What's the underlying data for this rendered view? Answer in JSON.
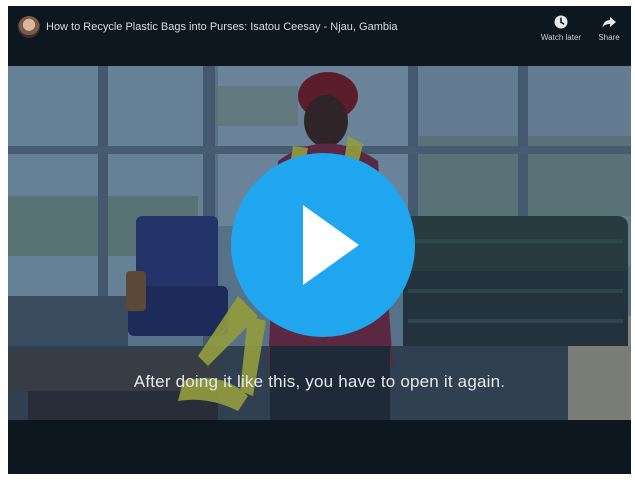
{
  "player": {
    "title": "How to Recycle Plastic Bags into Purses: Isatou Ceesay - Njau, Gambia",
    "watch_later_label": "Watch later",
    "share_label": "Share",
    "caption": "After doing it like this, you have to open it again.",
    "accent_color": "#1fa6ee",
    "icons": {
      "watch_later": "clock-icon",
      "share": "share-arrow-icon",
      "play": "play-icon"
    }
  }
}
